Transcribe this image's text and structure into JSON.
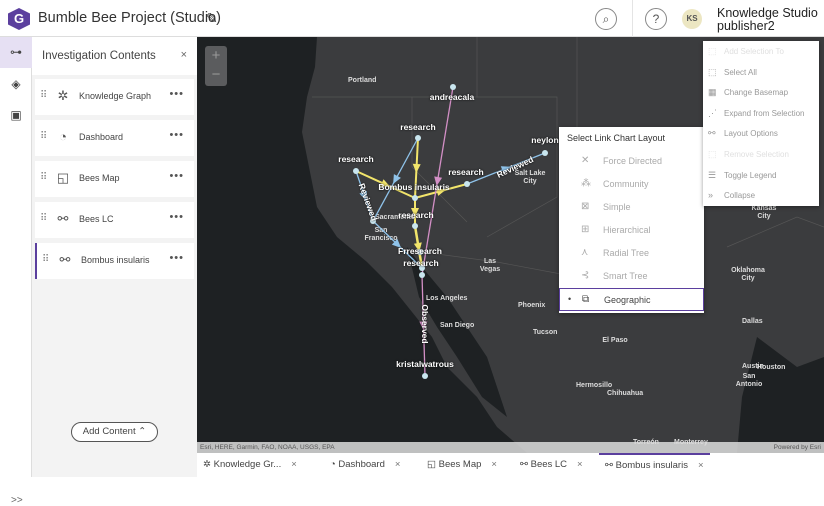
{
  "app": {
    "logo_letter": "G",
    "title": "Bumble Bee Project (Studio)",
    "edit_icon": "pencil-icon"
  },
  "header": {
    "search_icon": "search-icon",
    "help_label": "?",
    "avatar_initials": "KS",
    "user_name": "Knowledge Studio",
    "user_id": "publisher2"
  },
  "rail": {
    "items": [
      {
        "icon": "contents-icon"
      },
      {
        "icon": "layers-icon"
      },
      {
        "icon": "save-icon"
      }
    ],
    "expand_label": ">>"
  },
  "panel": {
    "title": "Investigation Contents",
    "close": "×",
    "items": [
      {
        "label": "Knowledge Graph",
        "icon": "knowledge-graph-icon"
      },
      {
        "label": "Dashboard",
        "icon": "dashboard-icon"
      },
      {
        "label": "Bees Map",
        "icon": "map-icon"
      },
      {
        "label": "Bees LC",
        "icon": "link-chart-icon"
      },
      {
        "label": "Bombus insularis",
        "icon": "link-chart-icon",
        "active": true
      }
    ],
    "more": "•••",
    "add_content": "Add Content ⌃"
  },
  "map": {
    "zoom_in": "+",
    "zoom_out": "−",
    "attribution": "Esri, HERE, Garmin, FAO, NOAA, USGS, EPA",
    "powered_by": "Powered by Esri",
    "cities": [
      "Portland",
      "Salt Lake City",
      "Sacramento",
      "San Francisco",
      "Las Vegas",
      "Los Angeles",
      "San Diego",
      "Phoenix",
      "Tucson",
      "El Paso",
      "Hermosillo",
      "Chihuahua",
      "Oklahoma City",
      "Dallas",
      "Austin",
      "San Antonio",
      "Houston",
      "Kansas City",
      "Torreón",
      "Monterrey"
    ],
    "graph": {
      "nodes": [
        "andreacala",
        "research",
        "research",
        "Bombus insularis",
        "research",
        "neylon",
        "research",
        "Frresearch",
        "research",
        "kristalwatrous"
      ],
      "edge_labels": [
        "Reviewed",
        "Reviewed",
        "Observed"
      ],
      "colors": {
        "yellow": "#f2e56b",
        "blue": "#8fc3ea",
        "pink": "#d38fc6",
        "node": "#c9e6ef"
      }
    }
  },
  "layout_menu": {
    "title": "Select Link Chart Layout",
    "options": [
      {
        "label": "Force Directed",
        "icon": "force-directed-icon"
      },
      {
        "label": "Community",
        "icon": "community-icon"
      },
      {
        "label": "Simple",
        "icon": "simple-icon"
      },
      {
        "label": "Hierarchical",
        "icon": "hierarchical-icon"
      },
      {
        "label": "Radial Tree",
        "icon": "radial-tree-icon"
      },
      {
        "label": "Smart Tree",
        "icon": "smart-tree-icon"
      },
      {
        "label": "Geographic",
        "icon": "geographic-icon",
        "selected": true
      }
    ],
    "selected_marker": "•"
  },
  "action_menu": {
    "items": [
      {
        "label": "Add Selection To",
        "disabled": true
      },
      {
        "label": "Select All"
      },
      {
        "label": "Change Basemap"
      },
      {
        "label": "Expand from Selection"
      },
      {
        "label": "Layout Options"
      },
      {
        "label": "Remove Selection",
        "disabled": true
      },
      {
        "label": "Toggle Legend"
      },
      {
        "label": "Collapse"
      }
    ]
  },
  "tabs": [
    {
      "label": "Knowledge Gr...",
      "icon": "knowledge-graph-icon"
    },
    {
      "label": "Dashboard",
      "icon": "dashboard-icon"
    },
    {
      "label": "Bees Map",
      "icon": "map-icon"
    },
    {
      "label": "Bees LC",
      "icon": "link-chart-icon"
    },
    {
      "label": "Bombus insularis",
      "icon": "link-chart-icon",
      "active": true
    }
  ],
  "tab_close": "×",
  "accent": "#5b3f9e"
}
